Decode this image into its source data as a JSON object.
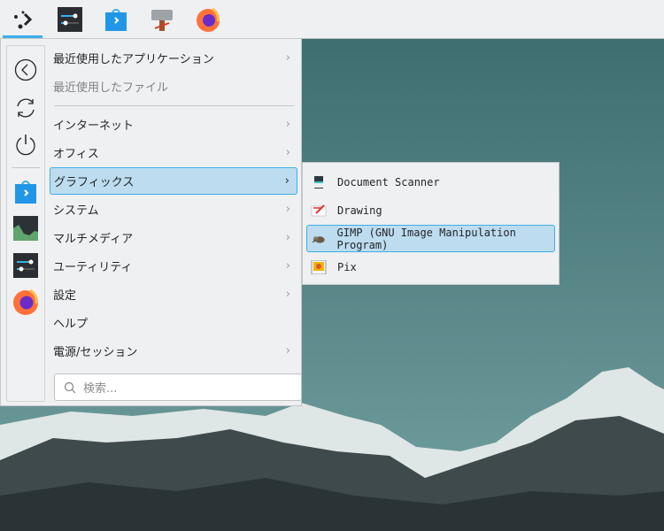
{
  "taskbar": {
    "apps": [
      "application-launcher",
      "system-settings",
      "discover",
      "kde-connect-tool",
      "firefox"
    ]
  },
  "sidebar": {
    "buttons": [
      "back",
      "refresh",
      "power"
    ],
    "favorites": [
      "discover",
      "system-monitor",
      "system-settings",
      "firefox"
    ]
  },
  "menu": {
    "items": [
      {
        "label": "最近使用したアプリケーション",
        "submenu": true
      },
      {
        "label": "最近使用したファイル",
        "submenu": false,
        "disabled": true
      },
      {
        "label": "インターネット",
        "submenu": true
      },
      {
        "label": "オフィス",
        "submenu": true
      },
      {
        "label": "グラフィックス",
        "submenu": true,
        "selected": true
      },
      {
        "label": "システム",
        "submenu": true
      },
      {
        "label": "マルチメディア",
        "submenu": true
      },
      {
        "label": "ユーティリティ",
        "submenu": true
      },
      {
        "label": "設定",
        "submenu": true
      },
      {
        "label": "ヘルプ",
        "submenu": false
      },
      {
        "label": "電源/セッション",
        "submenu": true
      }
    ],
    "chevron": "›"
  },
  "search": {
    "placeholder": "検索..."
  },
  "submenu": {
    "items": [
      {
        "label": "Document Scanner"
      },
      {
        "label": "Drawing"
      },
      {
        "label": "GIMP (GNU Image Manipulation Program)",
        "selected": true
      },
      {
        "label": "Pix"
      }
    ]
  },
  "colors": {
    "accent": "#3daee9",
    "selection": "#bddcef",
    "panel": "#eff0f1"
  }
}
